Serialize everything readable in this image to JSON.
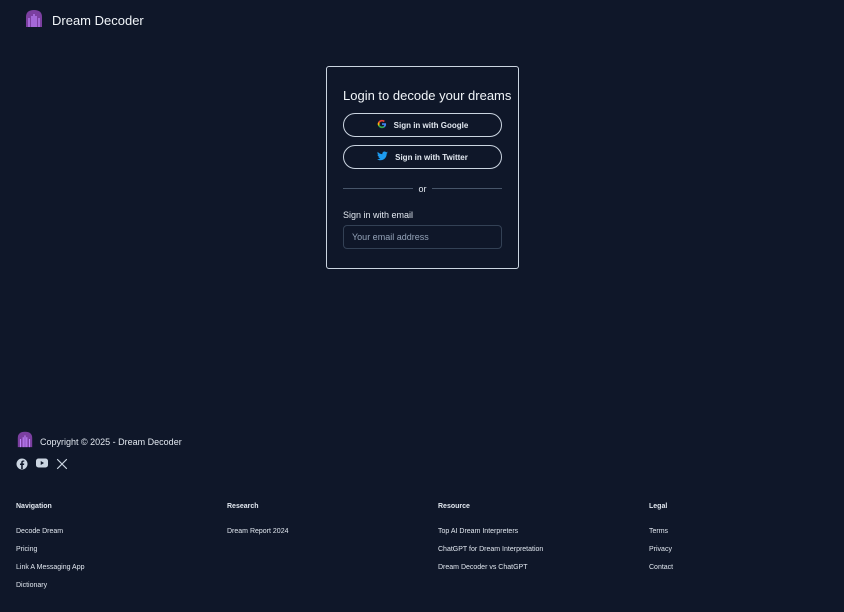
{
  "header": {
    "brand": "Dream Decoder"
  },
  "login": {
    "title": "Login to decode your dreams",
    "google_label": "Sign in with Google",
    "twitter_label": "Sign in with Twitter",
    "divider_text": "or",
    "email_label": "Sign in with email",
    "email_placeholder": "Your email address"
  },
  "footer": {
    "copyright": "Copyright © 2025 - Dream Decoder",
    "socials": [
      "facebook-icon",
      "youtube-icon",
      "x-icon"
    ],
    "columns": [
      {
        "title": "Navigation",
        "links": [
          "Decode Dream",
          "Pricing",
          "Link A Messaging App",
          "Dictionary"
        ]
      },
      {
        "title": "Research",
        "links": [
          "Dream Report 2024"
        ]
      },
      {
        "title": "Resource",
        "links": [
          "Top AI Dream Interpreters",
          "ChatGPT for Dream Interpretation",
          "Dream Decoder vs ChatGPT"
        ]
      },
      {
        "title": "Legal",
        "links": [
          "Terms",
          "Privacy",
          "Contact"
        ]
      }
    ]
  },
  "colors": {
    "background": "#0f1729",
    "logo": "#7b3fa0",
    "twitter": "#1d9bf0"
  }
}
